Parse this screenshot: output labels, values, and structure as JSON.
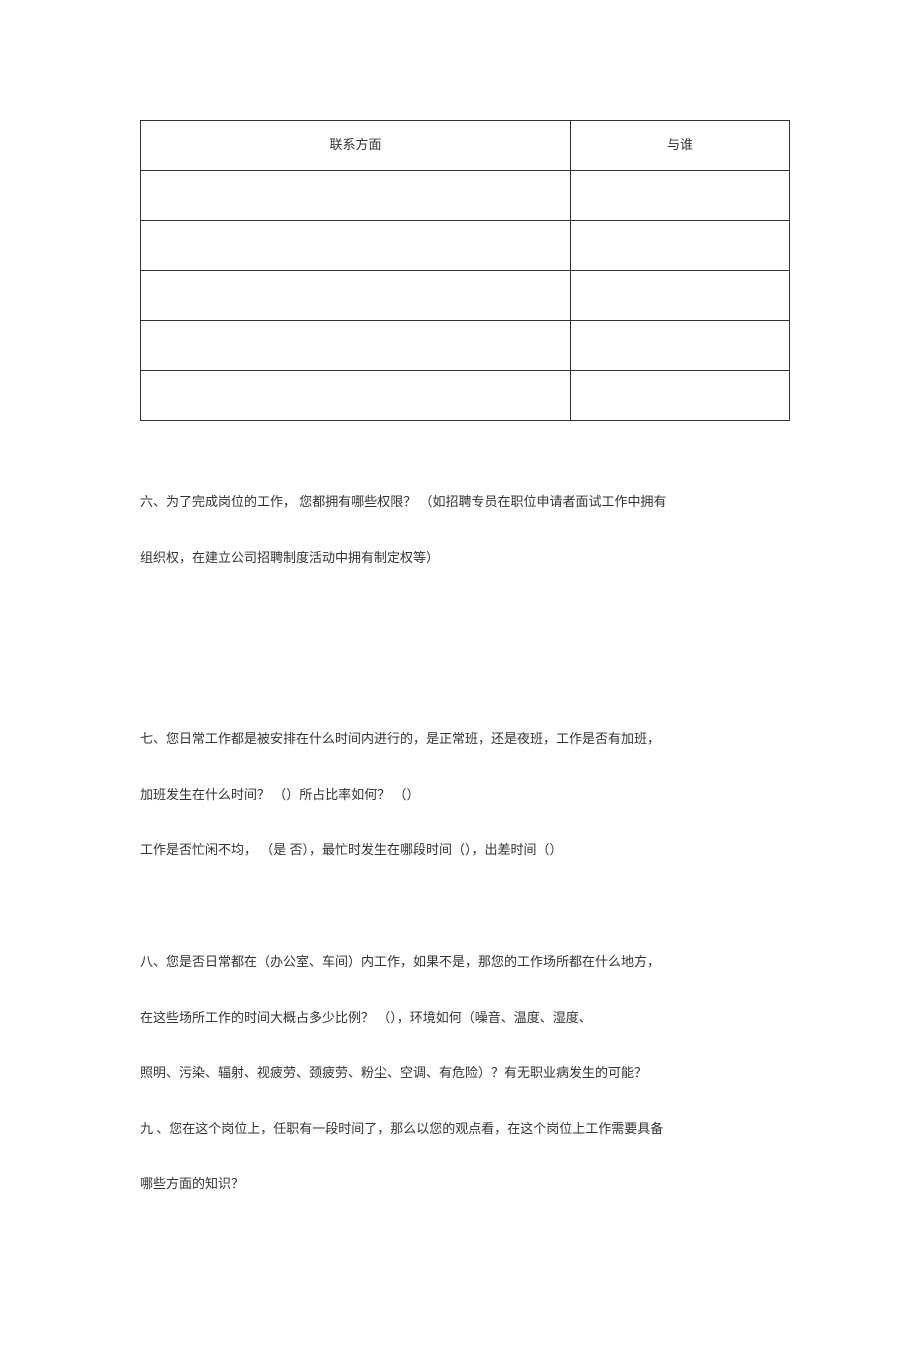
{
  "table": {
    "headers": {
      "col1": "联系方面",
      "col2": "与谁"
    },
    "rows": [
      {
        "col1": "",
        "col2": ""
      },
      {
        "col1": "",
        "col2": ""
      },
      {
        "col1": "",
        "col2": ""
      },
      {
        "col1": "",
        "col2": ""
      },
      {
        "col1": "",
        "col2": ""
      }
    ]
  },
  "questions": {
    "q6_line1": "六、为了完成岗位的工作，  您都拥有哪些权限？ （如招聘专员在职位申请者面试工作中拥有",
    "q6_line2": "组织权，在建立公司招聘制度活动中拥有制定权等）",
    "q7_line1": "七、您日常工作都是被安排在什么时间内进行的，是正常班，还是夜班，工作是否有加班，",
    "q7_line2": "加班发生在什么时间？ （）所占比率如何？ （）",
    "q7_line3": "工作是否忙闲不均， （是  否），最忙时发生在哪段时间（），出差时间（）",
    "q8_line1": "八、您是否日常都在（办公室、车间）内工作，如果不是，那您的工作场所都在什么地方，",
    "q8_line2": "在这些场所工作的时间大概占多少比例？ （），环境如何（噪音、温度、湿度、",
    "q8_line3": "照明、污染、辐射、视疲劳、颈疲劳、粉尘、空调、有危险）？有无职业病发生的可能？",
    "q9_line1": " 九 、您在这个岗位上，任职有一段时间了，那么以您的观点看，在这个岗位上工作需要具备",
    "q9_line2": "哪些方面的知识？"
  }
}
